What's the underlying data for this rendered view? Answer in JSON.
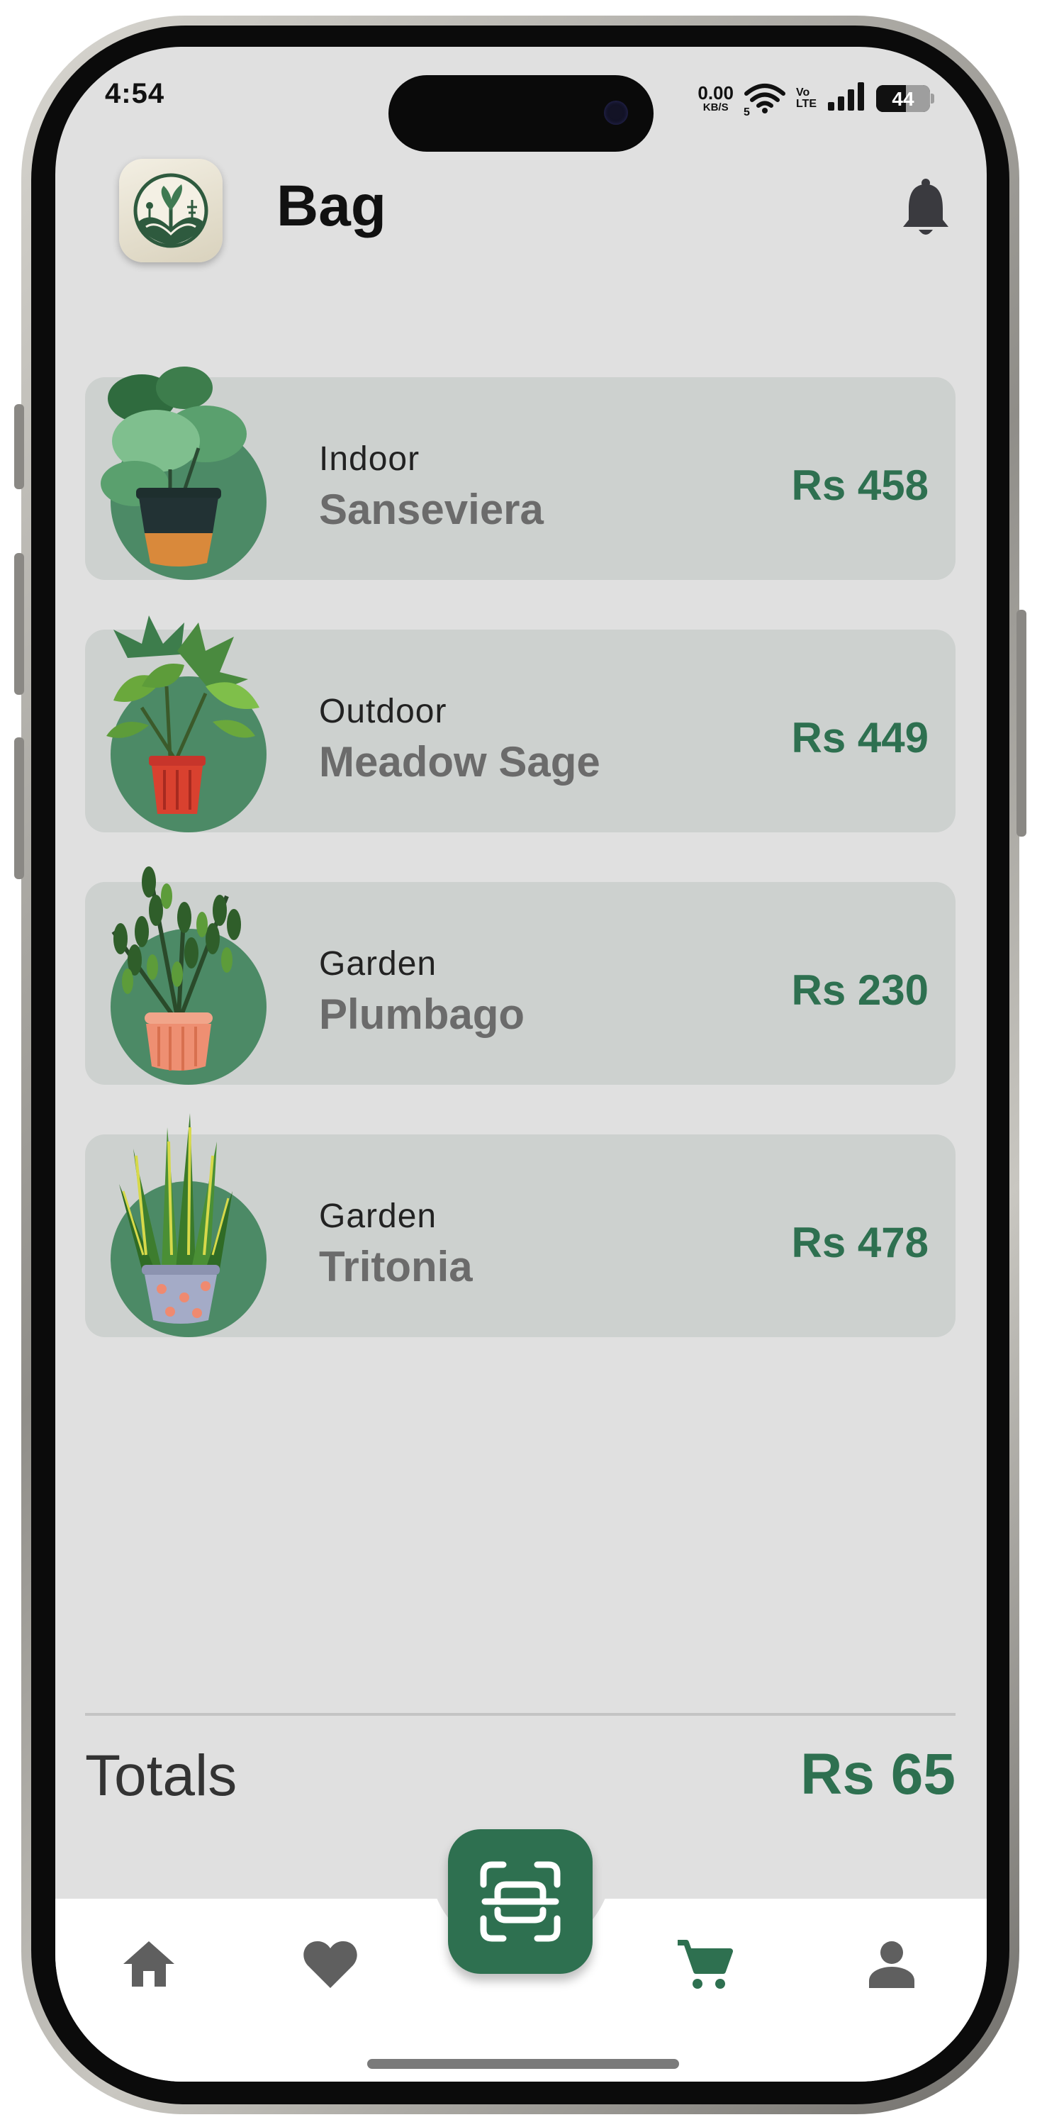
{
  "status_bar": {
    "time": "4:54",
    "speed_value": "0.00",
    "speed_unit": "KB/S",
    "wifi_sub": "5",
    "volte_top": "Vo",
    "volte_bottom": "LTE",
    "battery": "44"
  },
  "header": {
    "title": "Bag",
    "logo_icon": "plant-logo-icon",
    "notification_icon": "bell-icon"
  },
  "cart": {
    "items": [
      {
        "category": "Indoor",
        "name": "Sanseviera",
        "price": "Rs 458"
      },
      {
        "category": "Outdoor",
        "name": "Meadow Sage",
        "price": "Rs 449"
      },
      {
        "category": "Garden",
        "name": "Plumbago",
        "price": "Rs 230"
      },
      {
        "category": "Garden",
        "name": "Tritonia",
        "price": "Rs 478"
      }
    ]
  },
  "totals": {
    "label": "Totals",
    "value": "Rs 65"
  },
  "bottom_nav": {
    "items": [
      "home-icon",
      "heart-icon",
      "scan-icon",
      "cart-icon",
      "profile-icon"
    ],
    "active": "cart-icon"
  },
  "colors": {
    "accent": "#2e7050",
    "item_bg": "#cdd1cf",
    "screen_bg": "#e0e0e0",
    "plant_circle": "#4c8a66"
  }
}
